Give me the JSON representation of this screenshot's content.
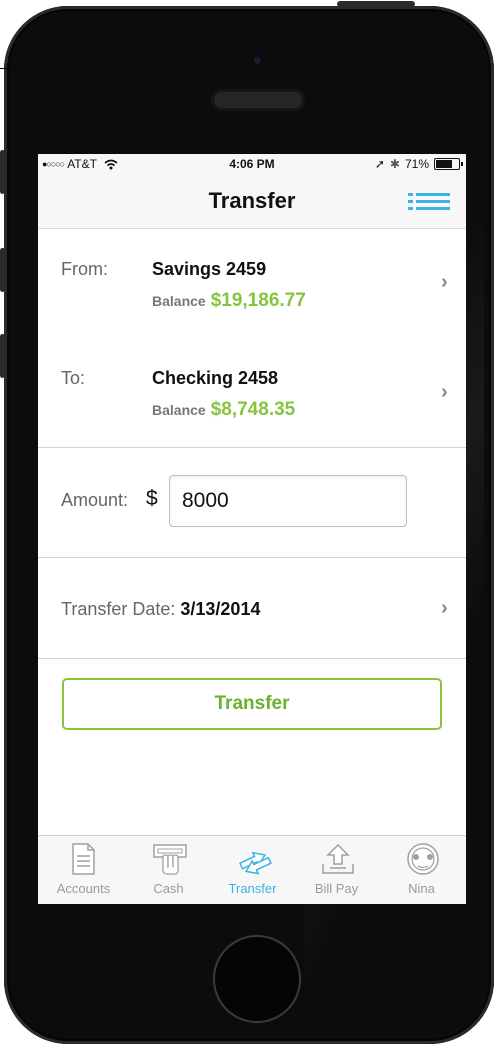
{
  "status_bar": {
    "signal": "●○○○○",
    "carrier": "AT&T",
    "wifi_icon": "wifi-icon",
    "time": "4:06 PM",
    "location_icon": "➚",
    "bluetooth_icon": "✱",
    "battery_percent": "71%",
    "battery_level": 0.71
  },
  "nav": {
    "title": "Transfer",
    "menu_icon": "list-menu-icon"
  },
  "from": {
    "label": "From:",
    "account": "Savings 2459",
    "balance_label": "Balance",
    "balance": "$19,186.77"
  },
  "to": {
    "label": "To:",
    "account": "Checking 2458",
    "balance_label": "Balance",
    "balance": "$8,748.35"
  },
  "amount": {
    "label": "Amount:",
    "currency": "$",
    "value": "8000"
  },
  "transfer_date": {
    "label": "Transfer Date:",
    "value": "3/13/2014"
  },
  "chevron": "›",
  "transfer_button": {
    "label": "Transfer"
  },
  "tabs": [
    {
      "label": "Accounts",
      "icon": "document-icon"
    },
    {
      "label": "Cash",
      "icon": "atm-cash-icon"
    },
    {
      "label": "Transfer",
      "icon": "transfer-arrows-icon",
      "active": true
    },
    {
      "label": "Bill Pay",
      "icon": "upload-tray-icon"
    },
    {
      "label": "Nina",
      "icon": "nina-assistant-icon"
    }
  ],
  "colors": {
    "accent_green": "#86c440",
    "active_blue": "#3ab4e6",
    "inactive_gray": "#9a9a9a"
  }
}
